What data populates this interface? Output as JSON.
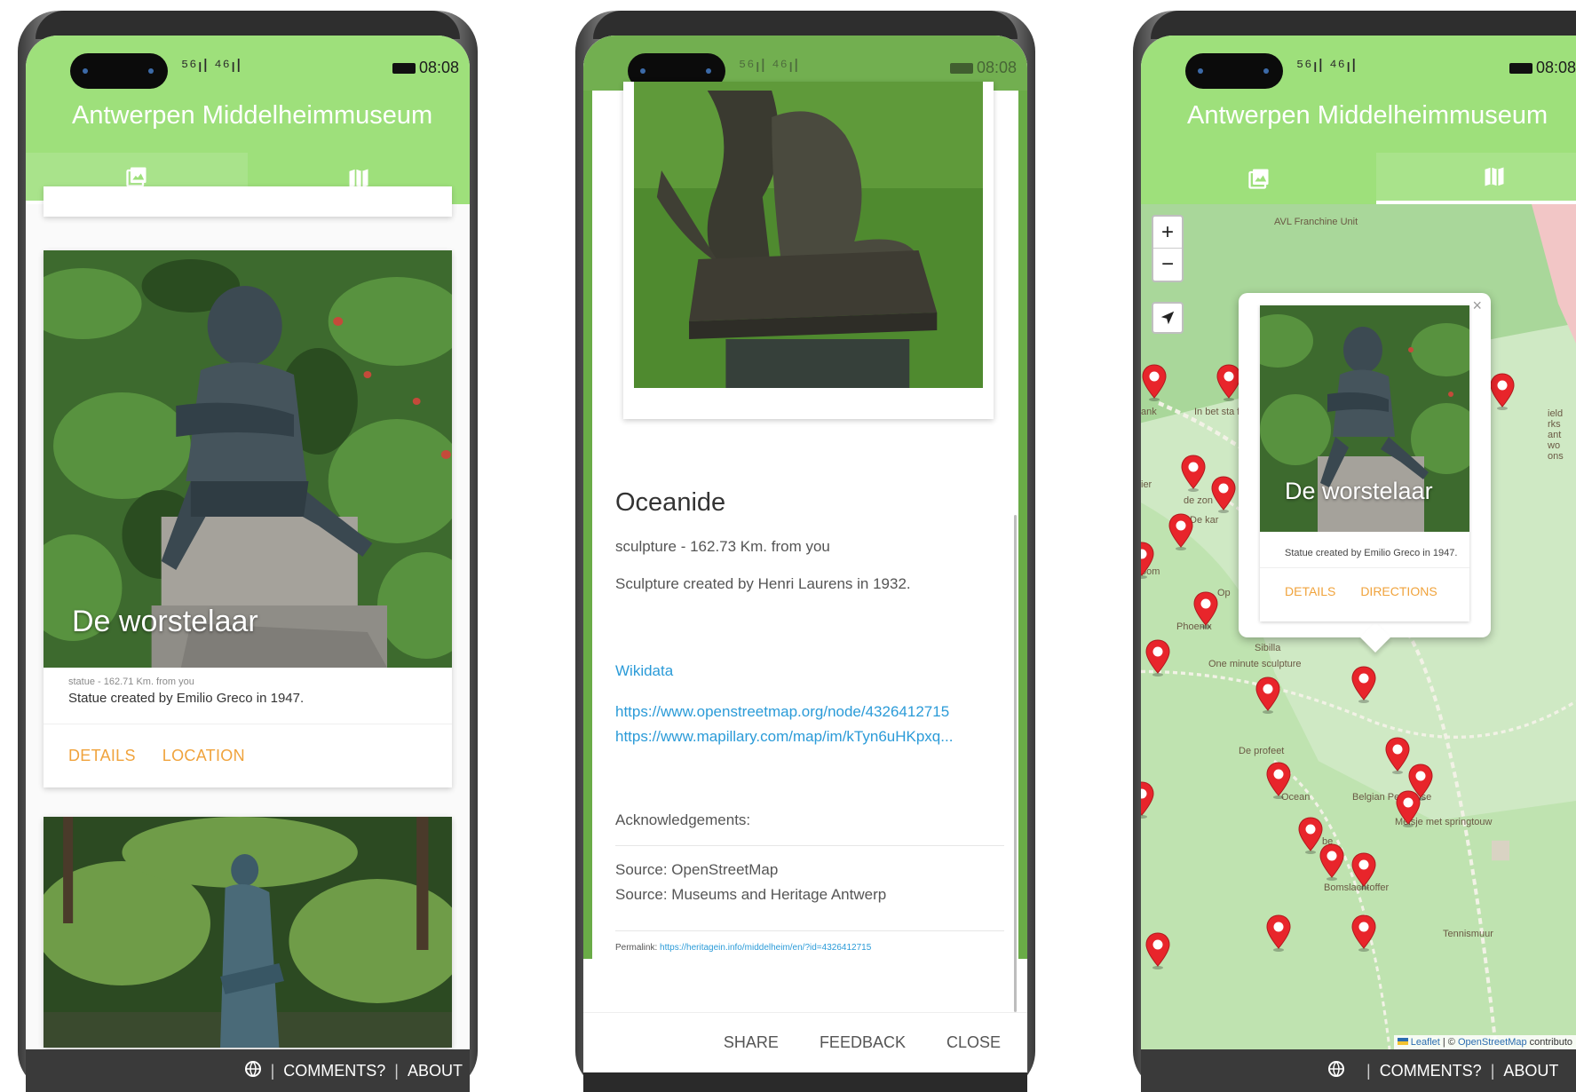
{
  "app": {
    "title": "Antwerpen Middelheimmuseum",
    "status_time": "08:08",
    "signal_text": "⁵⁶ıl ⁴⁶ıl ",
    "accent_color": "#9ee07b",
    "action_color": "#f0a33c",
    "link_color": "#2b9bd8"
  },
  "tabs": [
    {
      "icon": "gallery-icon"
    },
    {
      "icon": "map-icon"
    }
  ],
  "list": {
    "cards": [
      {
        "title": "De worstelaar",
        "meta": "statue - 162.71 Km. from you",
        "description": "Statue created by Emilio Greco in 1947.",
        "actions": [
          "DETAILS",
          "LOCATION"
        ]
      }
    ]
  },
  "footer": {
    "globe_icon": "globe-icon",
    "sep": "|",
    "comments": "COMMENTS?",
    "about": "ABOUT"
  },
  "detail": {
    "title": "Oceanide",
    "subtitle": "sculpture - 162.73 Km. from you",
    "description": "Sculpture created by Henri Laurens in 1932.",
    "wikidata_label": "Wikidata",
    "links": [
      "https://www.openstreetmap.org/node/4326412715",
      "https://www.mapillary.com/map/im/kTyn6uHKpxq..."
    ],
    "acknowledgements_label": "Acknowledgements:",
    "sources": [
      "Source: OpenStreetMap",
      "Source: Museums and Heritage Antwerp"
    ],
    "permalink_label": "Permalink:",
    "permalink_url": "https://heritagein.info/middelheim/en/?id=4326412715",
    "actions": [
      "SHARE",
      "FEEDBACK",
      "CLOSE"
    ]
  },
  "map": {
    "zoom_in": "+",
    "zoom_out": "−",
    "popup": {
      "title": "De worstelaar",
      "description": "Statue created by Emilio Greco in 1947.",
      "actions": [
        "DETAILS",
        "DIRECTIONS"
      ],
      "close": "×"
    },
    "labels": [
      "AVL Franchine Unit",
      "In bet sta fig",
      "de zon",
      "De kar",
      "Phoenix",
      "Sibilla",
      "One minute sculpture",
      "De profeet",
      "Ocean",
      "Belgian Penhouse",
      "Meisje met springtouw",
      "Bomslachtoffer",
      "Tennismuur",
      "ank",
      "oom",
      "ier",
      "ield rks ant wo ons",
      "Op",
      "be"
    ],
    "attribution_leaflet": "Leaflet",
    "attribution_sep": " | © ",
    "attribution_osm": "OpenStreetMap",
    "attribution_tail": " contributo"
  }
}
